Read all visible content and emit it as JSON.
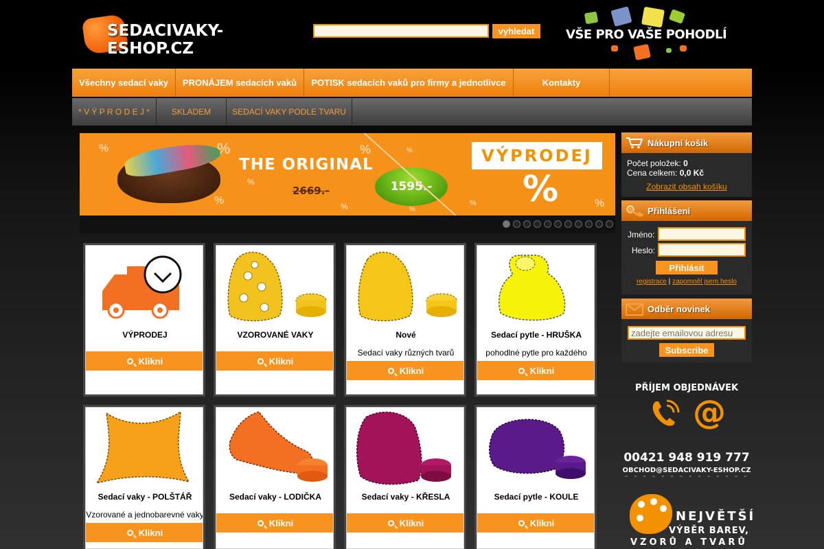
{
  "header": {
    "logo_text": "SEDACIVAKY-ESHOP.CZ",
    "search_placeholder": "",
    "search_button": "vyhledat",
    "slogan": "VŠE PRO VAŠE POHODLÍ"
  },
  "nav_main": [
    "Všechny sedací vaky",
    "PRONÁJEM sedacích vaků",
    "POTISK sedacích vaků pro firmy a jednotlivce",
    "Kontakty"
  ],
  "nav_sub": [
    "* V Ý P R O D E J *",
    "SKLADEM",
    "SEDACÍ VAKY PODLE TVARU"
  ],
  "banner": {
    "title": "THE ORIGINAL",
    "old_price": "2669.-",
    "new_price": "1595.-",
    "sale_label": "VÝPRODEJ",
    "percent": "%",
    "slides_count": 11,
    "active_slide": 1
  },
  "products": [
    {
      "title": "VÝPRODEJ",
      "desc": "",
      "button": "Klikni",
      "icon": "delivery-truck-clock-icon"
    },
    {
      "title": "VZOROVANÉ VAKY",
      "desc": "",
      "button": "Klikni",
      "icon": "patterned-beanbag-icon"
    },
    {
      "title": "Nové",
      "desc": "Sedací vaky různých tvarů",
      "button": "Klikni",
      "icon": "yellow-beanbag-icon"
    },
    {
      "title": "Sedací pytle - HRUŠKA",
      "desc": "pohodlné pytle pro každého",
      "button": "Klikni",
      "icon": "pear-beanbag-icon"
    },
    {
      "title": "Sedací vaky - POLŠTÁŘ",
      "desc": "Vzorované a jednobarevné vaky",
      "button": "Klikni",
      "icon": "pillow-beanbag-icon"
    },
    {
      "title": "Sedací vaky - LODIČKA",
      "desc": "",
      "button": "Klikni",
      "icon": "boat-beanbag-icon"
    },
    {
      "title": "Sedací vaky - KŘESLA",
      "desc": "",
      "button": "Klikni",
      "icon": "armchair-beanbag-icon"
    },
    {
      "title": "Sedací pytle - KOULE",
      "desc": "",
      "button": "Klikni",
      "icon": "ball-beanbag-icon"
    }
  ],
  "cart": {
    "title": "Nákupní košík",
    "items_label": "Počet položek:",
    "items_value": "0",
    "total_label": "Cena celkem:",
    "total_value": "0,0 Kč",
    "link": "Zobrazit obsah košíku"
  },
  "login": {
    "title": "Přihlášení",
    "name_label": "Jméno:",
    "pass_label": "Heslo:",
    "button": "Přihlásit",
    "register": "registrace",
    "forgot": "zapomněl jsem heslo",
    "separator": "|"
  },
  "newsletter": {
    "title": "Odběr novinek",
    "placeholder": "zadejte emailovou adresu",
    "button": "Subscribe"
  },
  "contact": {
    "heading": "PŘÍJEM OBJEDNÁVEK",
    "phone": "00421 948 919 777",
    "email": "OBCHOD@SEDACIVAKY-ESHOP.CZ",
    "separator": "- - - - - - - - - - - - - - - - - - - -"
  },
  "promo": {
    "line1": "NEJVĚTŠÍ",
    "line2": "VÝBĚR BAREV,",
    "line3": "VZORŮ A TVARŮ"
  },
  "colors": {
    "accent": "#f7931e",
    "nav_sub_text": "#f39c3c",
    "background": "#000000"
  }
}
